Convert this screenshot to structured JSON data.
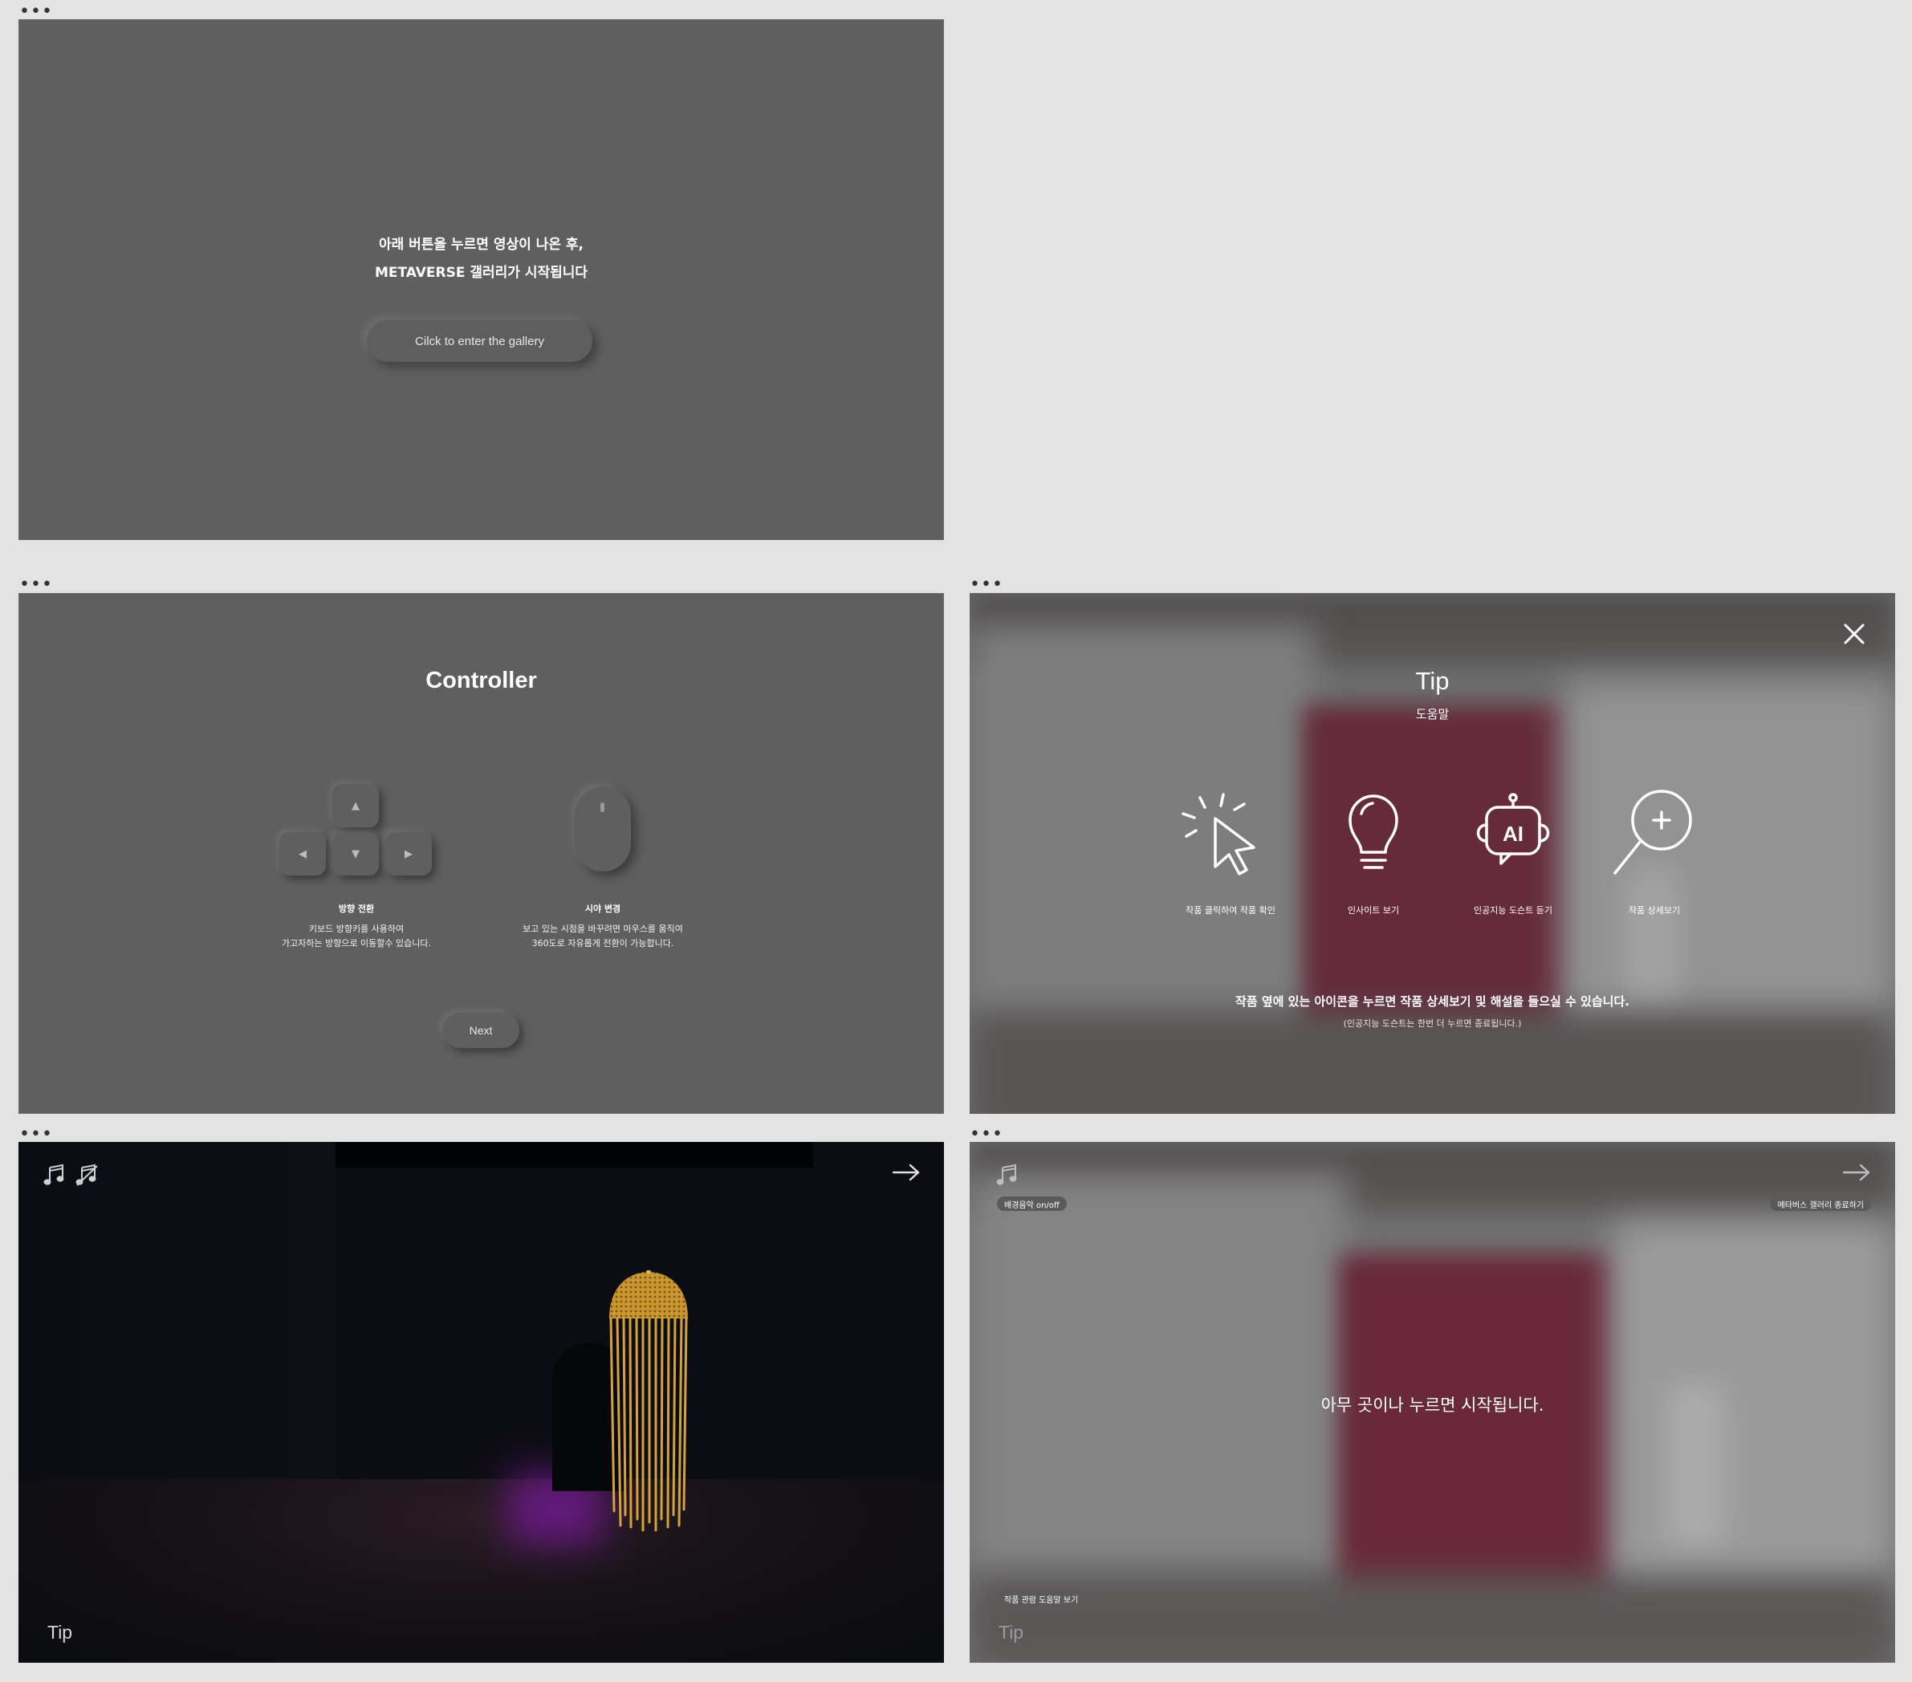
{
  "intro": {
    "line1": "아래 버튼을 누르면 영상이 나온 후,",
    "line2": "METAVERSE 갤러리가 시작됩니다",
    "enter_button": "Cilck to enter the gallery"
  },
  "controller": {
    "title": "Controller",
    "keyboard": {
      "label": "방향 전환",
      "desc_line1": "키보드 방향키를 사용하여",
      "desc_line2": "가고자하는 방향으로 이동할수 있습니다."
    },
    "mouse": {
      "label": "시야 변경",
      "desc_line1": "보고 있는 시점을 바꾸려면 마우스를 움직여",
      "desc_line2": "360도로 자유롭게 전환이 가능합니다."
    },
    "next_button": "Next"
  },
  "tip": {
    "title": "Tip",
    "subtitle": "도움말",
    "items": [
      {
        "label": "작품 클릭하여 작품 확인",
        "icon": "cursor-click-icon"
      },
      {
        "label": "인사이트 보기",
        "icon": "lightbulb-icon"
      },
      {
        "label": "인공지능 도슨트 듣기",
        "icon": "ai-docent-icon"
      },
      {
        "label": "작품 상세보기",
        "icon": "zoom-in-icon"
      }
    ],
    "main_text": "작품 옆에 있는 아이콘을 누르면 작품 상세보기 및 해설을 들으실 수 있습니다.",
    "note": "(인공지능 도슨트는 한번 더 누르면 종료됩니다.)"
  },
  "gallery": {
    "tip_link": "Tip"
  },
  "start": {
    "message": "아무 곳이나 누르면 시작됩니다.",
    "bgm_pill": "배경음악 on/off",
    "exit_pill": "메타버스 갤러리 종료하기",
    "guide_pill": "작품 관람 도움말 보기",
    "tip_link": "Tip"
  },
  "colors": {
    "panel_gray": "#5f5f5f",
    "accent_red": "#7a2c42",
    "sculpture_gold": "#c9962f",
    "page_bg": "#e3e3e3"
  }
}
